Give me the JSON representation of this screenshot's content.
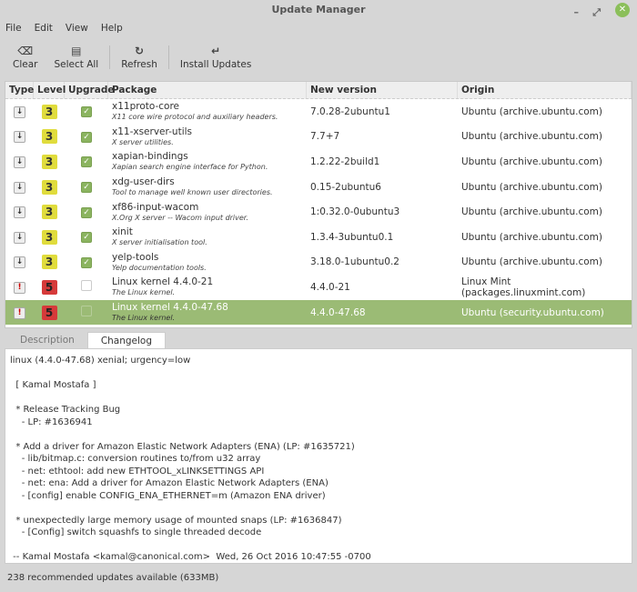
{
  "window": {
    "title": "Update Manager"
  },
  "menu": [
    "File",
    "Edit",
    "View",
    "Help"
  ],
  "toolbar": {
    "clear": "Clear",
    "select_all": "Select All",
    "refresh": "Refresh",
    "install": "Install Updates"
  },
  "columns": [
    "Type",
    "Level",
    "Upgrade",
    "Package",
    "New version",
    "Origin"
  ],
  "rows": [
    {
      "type": "package",
      "level": "3",
      "upgrade": true,
      "name": "x11proto-core",
      "desc": "X11 core wire protocol and auxiliary headers.",
      "version": "7.0.28-2ubuntu1",
      "origin": "Ubuntu (archive.ubuntu.com)"
    },
    {
      "type": "package",
      "level": "3",
      "upgrade": true,
      "name": "x11-xserver-utils",
      "desc": "X server utilities.",
      "version": "7.7+7",
      "origin": "Ubuntu (archive.ubuntu.com)"
    },
    {
      "type": "package",
      "level": "3",
      "upgrade": true,
      "name": "xapian-bindings",
      "desc": "Xapian search engine interface for Python.",
      "version": "1.2.22-2build1",
      "origin": "Ubuntu (archive.ubuntu.com)"
    },
    {
      "type": "package",
      "level": "3",
      "upgrade": true,
      "name": "xdg-user-dirs",
      "desc": "Tool to manage well known user directories.",
      "version": "0.15-2ubuntu6",
      "origin": "Ubuntu (archive.ubuntu.com)"
    },
    {
      "type": "package",
      "level": "3",
      "upgrade": true,
      "name": "xf86-input-wacom",
      "desc": "X.Org X server -- Wacom input driver.",
      "version": "1:0.32.0-0ubuntu3",
      "origin": "Ubuntu (archive.ubuntu.com)"
    },
    {
      "type": "package",
      "level": "3",
      "upgrade": true,
      "name": "xinit",
      "desc": "X server initialisation tool.",
      "version": "1.3.4-3ubuntu0.1",
      "origin": "Ubuntu (archive.ubuntu.com)"
    },
    {
      "type": "package",
      "level": "3",
      "upgrade": true,
      "name": "yelp-tools",
      "desc": "Yelp documentation tools.",
      "version": "3.18.0-1ubuntu0.2",
      "origin": "Ubuntu (archive.ubuntu.com)"
    },
    {
      "type": "kernel",
      "level": "5",
      "upgrade": false,
      "name": "Linux kernel 4.4.0-21",
      "desc": "The Linux kernel.",
      "version": "4.4.0-21",
      "origin": "Linux Mint (packages.linuxmint.com)"
    },
    {
      "type": "kernel",
      "level": "5",
      "upgrade": false,
      "name": "Linux kernel 4.4.0-47.68",
      "desc": "The Linux kernel.",
      "version": "4.4.0-47.68",
      "origin": "Ubuntu (security.ubuntu.com)",
      "selected": true
    }
  ],
  "tabs": {
    "description": "Description",
    "changelog": "Changelog"
  },
  "changelog": "linux (4.4.0-47.68) xenial; urgency=low\n\n  [ Kamal Mostafa ]\n\n  * Release Tracking Bug\n    - LP: #1636941\n\n  * Add a driver for Amazon Elastic Network Adapters (ENA) (LP: #1635721)\n    - lib/bitmap.c: conversion routines to/from u32 array\n    - net: ethtool: add new ETHTOOL_xLINKSETTINGS API\n    - net: ena: Add a driver for Amazon Elastic Network Adapters (ENA)\n    - [config] enable CONFIG_ENA_ETHERNET=m (Amazon ENA driver)\n\n  * unexpectedly large memory usage of mounted snaps (LP: #1636847)\n    - [Config] switch squashfs to single threaded decode\n\n -- Kamal Mostafa <kamal@canonical.com>  Wed, 26 Oct 2016 10:47:55 -0700",
  "status": "238 recommended updates available (633MB)"
}
